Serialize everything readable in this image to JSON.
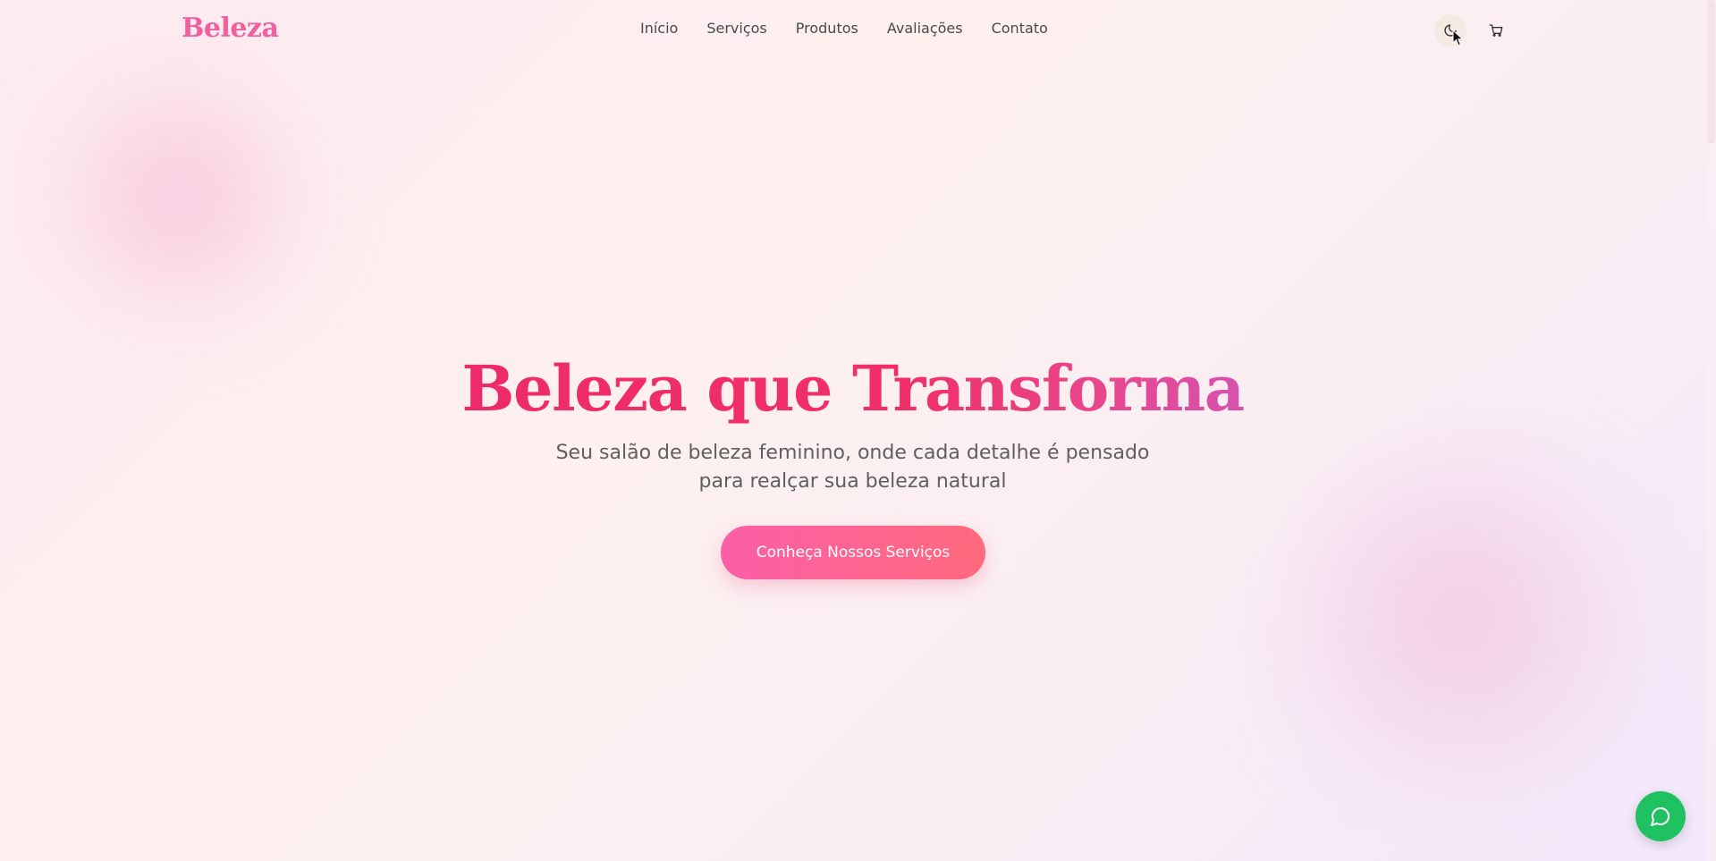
{
  "brand": {
    "logo_text": "Beleza"
  },
  "nav": {
    "links": [
      {
        "label": "Início"
      },
      {
        "label": "Serviços"
      },
      {
        "label": "Produtos"
      },
      {
        "label": "Avaliações"
      },
      {
        "label": "Contato"
      }
    ]
  },
  "header_actions": {
    "theme_toggle_icon": "moon-icon",
    "cart_icon": "cart-icon"
  },
  "hero": {
    "title": "Beleza que Transforma",
    "subtitle": "Seu salão de beleza feminino, onde cada detalhe é pensado para realçar sua beleza natural",
    "cta_label": "Conheça Nossos Serviços"
  },
  "floating": {
    "chat_icon": "whatsapp-chat-icon"
  },
  "colors": {
    "brand_pink": "#f0609e",
    "title_start": "#ee2a6a",
    "title_end": "#c95ac8",
    "cta_start": "#fb5fa7",
    "cta_end": "#ff6a7d",
    "whatsapp_green": "#1fc160"
  }
}
